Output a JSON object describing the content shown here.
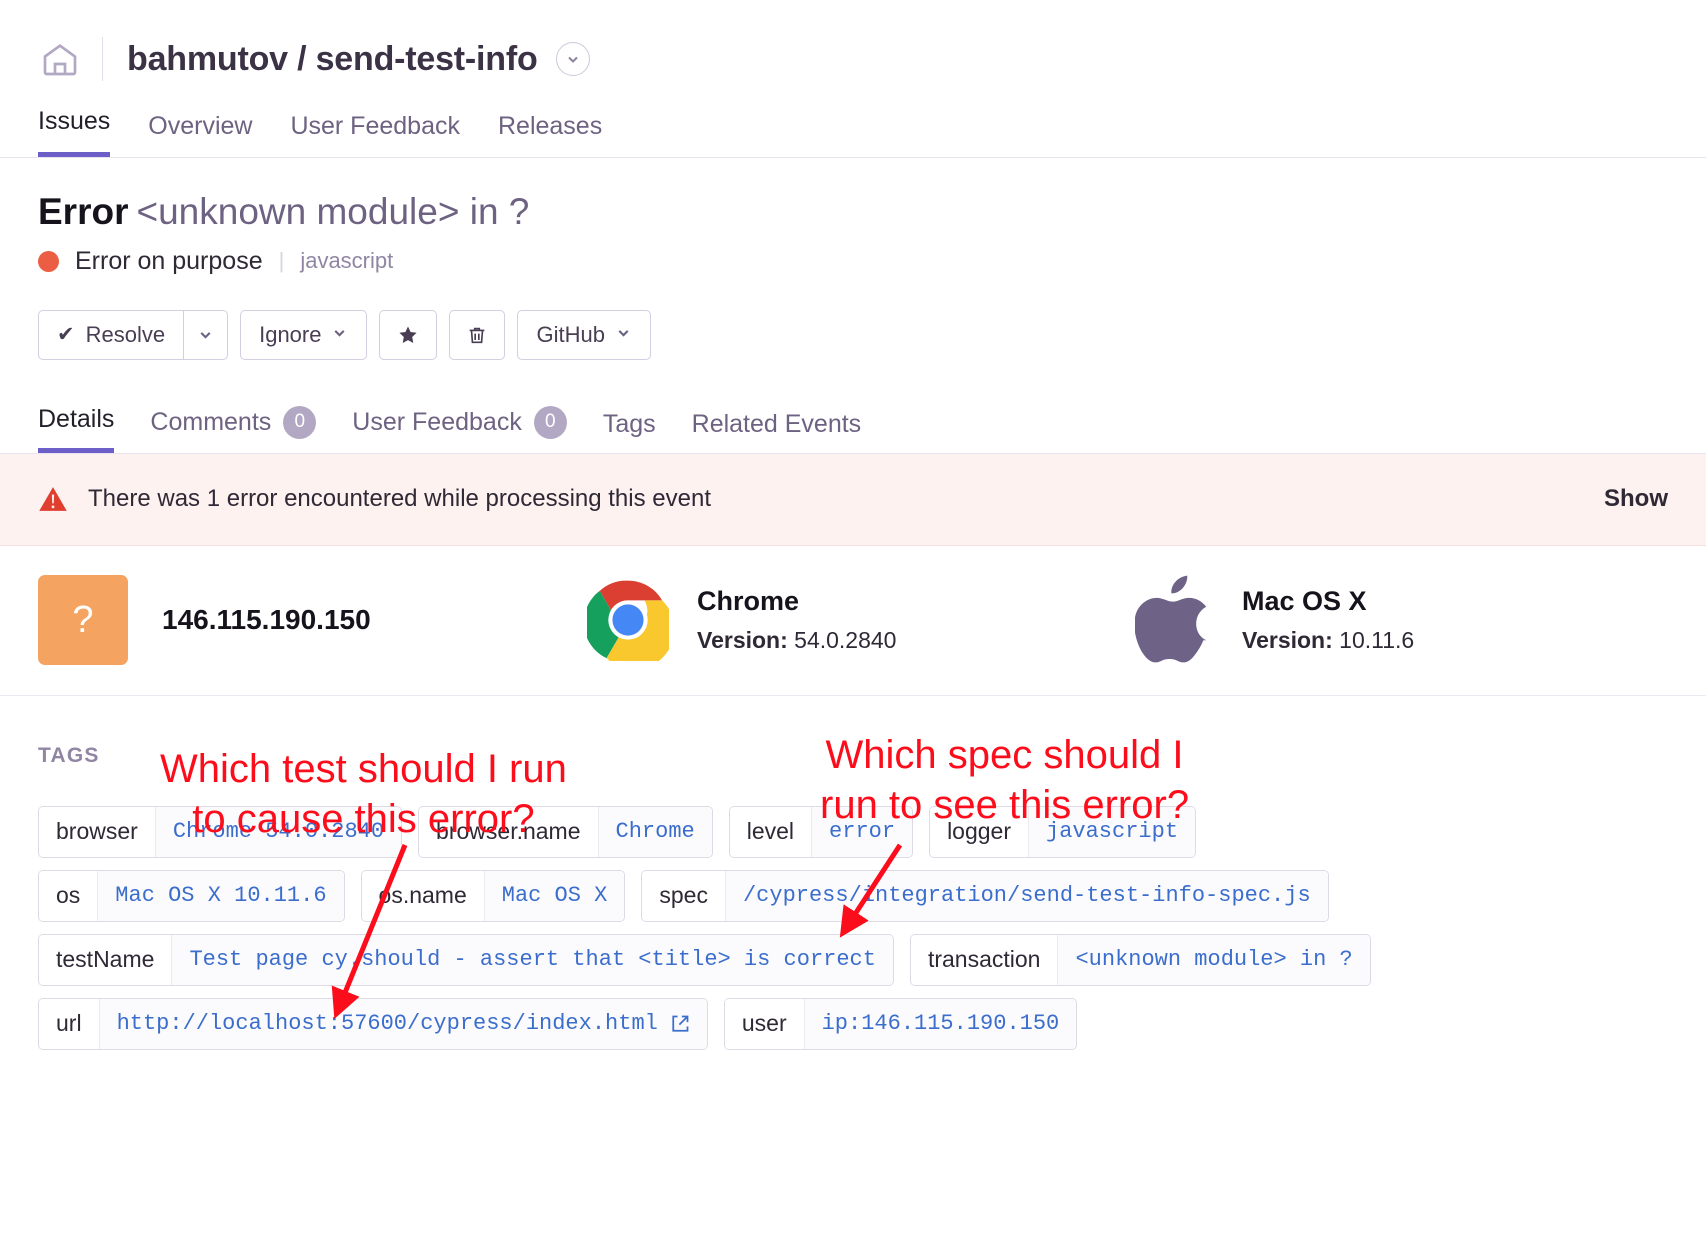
{
  "header": {
    "home_icon": "home-icon",
    "project": "bahmutov / send-test-info",
    "caret_icon": "chevron-down-icon"
  },
  "top_nav": [
    {
      "label": "Issues",
      "active": true
    },
    {
      "label": "Overview",
      "active": false
    },
    {
      "label": "User Feedback",
      "active": false
    },
    {
      "label": "Releases",
      "active": false
    }
  ],
  "issue": {
    "type": "Error",
    "culprit": "<unknown module> in ?",
    "message": "Error on purpose",
    "pipe": "|",
    "logger": "javascript",
    "level_color": "#ec5e44"
  },
  "actions": {
    "resolve": "Resolve",
    "resolve_check": "✔",
    "resolve_caret": "chevron-down-icon",
    "ignore": "Ignore",
    "ignore_caret": "chevron-down-icon",
    "bookmark_icon": "star-icon",
    "delete_icon": "trash-icon",
    "github": "GitHub",
    "github_caret": "chevron-down-icon"
  },
  "detail_tabs": [
    {
      "label": "Details",
      "count": null,
      "active": true
    },
    {
      "label": "Comments",
      "count": "0",
      "active": false
    },
    {
      "label": "User Feedback",
      "count": "0",
      "active": false
    },
    {
      "label": "Tags",
      "count": null,
      "active": false
    },
    {
      "label": "Related Events",
      "count": null,
      "active": false
    }
  ],
  "banner": {
    "icon": "warning-triangle-icon",
    "message": "There was 1 error encountered while processing this event",
    "action": "Show"
  },
  "context": {
    "user": {
      "avatar_glyph": "?",
      "ip": "146.115.190.150"
    },
    "browser": {
      "icon": "chrome-icon",
      "name": "Chrome",
      "version_label": "Version:",
      "version": "54.0.2840"
    },
    "os": {
      "icon": "apple-icon",
      "name": "Mac OS X",
      "version_label": "Version:",
      "version": "10.11.6"
    }
  },
  "tags": {
    "label": "TAGS",
    "rows": [
      [
        {
          "key": "browser",
          "value": "Chrome 54.0.2840"
        },
        {
          "key": "browser.name",
          "value": "Chrome"
        },
        {
          "key": "level",
          "value": "error"
        },
        {
          "key": "logger",
          "value": "javascript"
        }
      ],
      [
        {
          "key": "os",
          "value": "Mac OS X 10.11.6"
        },
        {
          "key": "os.name",
          "value": "Mac OS X"
        },
        {
          "key": "spec",
          "value": "/cypress/integration/send-test-info-spec.js"
        }
      ],
      [
        {
          "key": "testName",
          "value": "Test page cy.should - assert that <title> is correct"
        },
        {
          "key": "transaction",
          "value": "<unknown module> in ?"
        }
      ],
      [
        {
          "key": "url",
          "value": "http://localhost:57600/cypress/index.html",
          "external": true
        },
        {
          "key": "user",
          "value": "ip:146.115.190.150"
        }
      ]
    ]
  },
  "annotations": {
    "color": "#fc0d1b",
    "test": "Which test should I run\nto cause this error?",
    "spec": "Which spec should I\nrun to see this error?"
  }
}
